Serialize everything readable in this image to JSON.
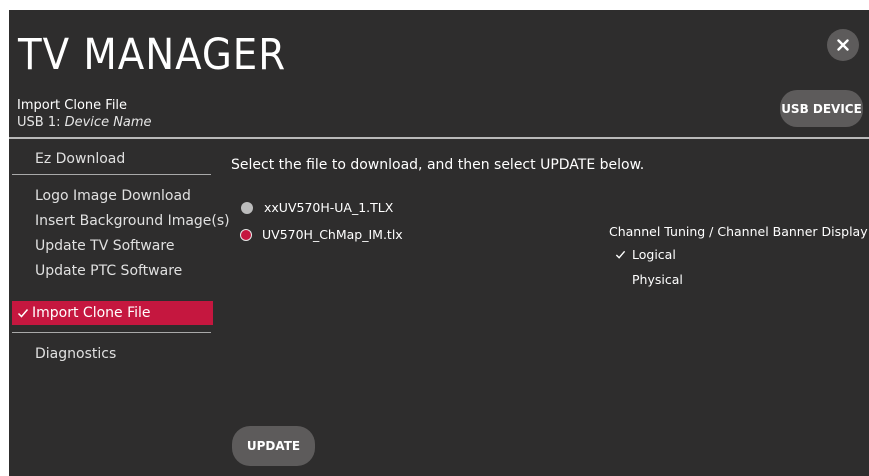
{
  "header": {
    "title": "TV MANAGER",
    "subtitle": "Import Clone File",
    "device_prefix": "USB 1:",
    "device_name": "Device Name",
    "usb_button": "USB DEVICE",
    "close_icon": "close-icon"
  },
  "sidebar": {
    "items": [
      {
        "label": "Ez Download"
      },
      {
        "label": "Logo Image Download"
      },
      {
        "label": "Insert Background Image(s)"
      },
      {
        "label": "Update TV Software"
      },
      {
        "label": "Update PTC Software"
      },
      {
        "label": "Import Clone File",
        "selected": true
      },
      {
        "label": "Diagnostics"
      }
    ]
  },
  "main": {
    "instruction": "Select the file to download, and then select UPDATE below.",
    "files": [
      {
        "name": "xxUV570H-UA_1.TLX",
        "selected": false
      },
      {
        "name": "UV570H_ChMap_IM.tlx",
        "selected": true
      }
    ],
    "channel_tuning": {
      "title": "Channel Tuning / Channel Banner Display",
      "options": [
        {
          "label": "Logical",
          "checked": true
        },
        {
          "label": "Physical",
          "checked": false
        }
      ]
    },
    "update_button": "UPDATE"
  },
  "colors": {
    "background": "#2e2d2d",
    "accent": "#c5173f",
    "button": "#5d5b5b"
  }
}
